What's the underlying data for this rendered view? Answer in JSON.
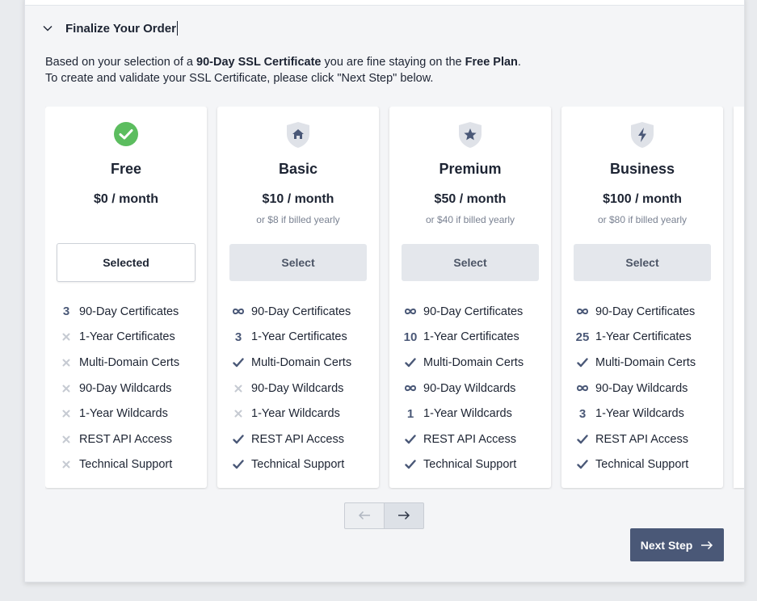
{
  "section": {
    "title": "Finalize Your Order"
  },
  "intro": {
    "line1_before": "Based on your selection of a ",
    "line1_cert": "90-Day SSL Certificate",
    "line1_middle": " you are fine staying on the ",
    "line1_plan": "Free Plan",
    "line1_end": ".",
    "line2": "To create and validate your SSL Certificate, please click \"Next Step\" below."
  },
  "colors": {
    "accent": "#4a5877",
    "success": "#5cbd5f",
    "muted_icon": "#c6cad2"
  },
  "plans": [
    {
      "name": "Free",
      "price": "$0 / month",
      "note": "",
      "button": "Selected",
      "selected": true,
      "icon": "check-circle-icon",
      "features": [
        {
          "mark": "3",
          "kind": "num",
          "label": "90-Day Certificates"
        },
        {
          "mark": "✕",
          "kind": "x",
          "label": "1-Year Certificates"
        },
        {
          "mark": "✕",
          "kind": "x",
          "label": "Multi-Domain Certs"
        },
        {
          "mark": "✕",
          "kind": "x",
          "label": "90-Day Wildcards"
        },
        {
          "mark": "✕",
          "kind": "x",
          "label": "1-Year Wildcards"
        },
        {
          "mark": "✕",
          "kind": "x",
          "label": "REST API Access"
        },
        {
          "mark": "✕",
          "kind": "x",
          "label": "Technical Support"
        }
      ]
    },
    {
      "name": "Basic",
      "price": "$10 / month",
      "note": "or $8 if billed yearly",
      "button": "Select",
      "selected": false,
      "icon": "shield-home-icon",
      "features": [
        {
          "mark": "∞",
          "kind": "inf",
          "label": "90-Day Certificates"
        },
        {
          "mark": "3",
          "kind": "num",
          "label": "1-Year Certificates"
        },
        {
          "mark": "✓",
          "kind": "check",
          "label": "Multi-Domain Certs"
        },
        {
          "mark": "✕",
          "kind": "x",
          "label": "90-Day Wildcards"
        },
        {
          "mark": "✕",
          "kind": "x",
          "label": "1-Year Wildcards"
        },
        {
          "mark": "✓",
          "kind": "check",
          "label": "REST API Access"
        },
        {
          "mark": "✓",
          "kind": "check",
          "label": "Technical Support"
        }
      ]
    },
    {
      "name": "Premium",
      "price": "$50 / month",
      "note": "or $40 if billed yearly",
      "button": "Select",
      "selected": false,
      "icon": "shield-star-icon",
      "features": [
        {
          "mark": "∞",
          "kind": "inf",
          "label": "90-Day Certificates"
        },
        {
          "mark": "10",
          "kind": "num",
          "label": "1-Year Certificates"
        },
        {
          "mark": "✓",
          "kind": "check",
          "label": "Multi-Domain Certs"
        },
        {
          "mark": "∞",
          "kind": "inf",
          "label": "90-Day Wildcards"
        },
        {
          "mark": "1",
          "kind": "num",
          "label": "1-Year Wildcards"
        },
        {
          "mark": "✓",
          "kind": "check",
          "label": "REST API Access"
        },
        {
          "mark": "✓",
          "kind": "check",
          "label": "Technical Support"
        }
      ]
    },
    {
      "name": "Business",
      "price": "$100 / month",
      "note": "or $80 if billed yearly",
      "button": "Select",
      "selected": false,
      "icon": "shield-bolt-icon",
      "features": [
        {
          "mark": "∞",
          "kind": "inf",
          "label": "90-Day Certificates"
        },
        {
          "mark": "25",
          "kind": "num",
          "label": "1-Year Certificates"
        },
        {
          "mark": "✓",
          "kind": "check",
          "label": "Multi-Domain Certs"
        },
        {
          "mark": "∞",
          "kind": "inf",
          "label": "90-Day Wildcards"
        },
        {
          "mark": "3",
          "kind": "num",
          "label": "1-Year Wildcards"
        },
        {
          "mark": "✓",
          "kind": "check",
          "label": "REST API Access"
        },
        {
          "mark": "✓",
          "kind": "check",
          "label": "Technical Support"
        }
      ]
    }
  ],
  "pager": {
    "prev_icon": "arrow-left-icon",
    "next_icon": "arrow-right-icon"
  },
  "next_step": {
    "label": "Next Step",
    "icon": "arrow-right-icon"
  }
}
